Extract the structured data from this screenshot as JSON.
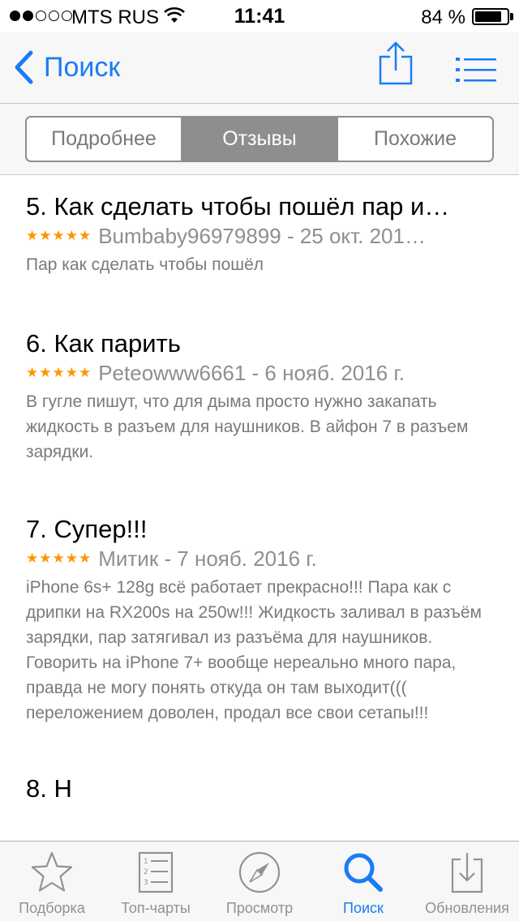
{
  "status_bar": {
    "carrier": "MTS RUS",
    "time": "11:41",
    "battery_percent": "84 %",
    "battery_level": 0.84,
    "signal_bars": 2
  },
  "navbar": {
    "back_label": "Поиск",
    "share_icon": "share-icon",
    "list_icon": "list-icon",
    "accent_color": "#1a7cf5"
  },
  "segmented": {
    "tabs": [
      {
        "label": "Подробнее",
        "active": false
      },
      {
        "label": "Отзывы",
        "active": true
      },
      {
        "label": "Похожие",
        "active": false
      }
    ]
  },
  "reviews": [
    {
      "title": "5. Как сделать чтобы пошёл пар и…",
      "stars": "★★★★★",
      "meta": "Bumbaby96979899 - 25 окт. 201…",
      "body": "Пар как сделать чтобы пошёл"
    },
    {
      "title": "6. Как парить",
      "stars": "★★★★★",
      "meta": "Peteowww6661 - 6 нояб. 2016 г.",
      "body": "В гугле пишут, что для дыма просто нужно закапать жидкость в разъем для наушников. В айфон 7 в разъем зарядки."
    },
    {
      "title": "7. Супер!!!",
      "stars": "★★★★★",
      "meta": "Митик - 7 нояб. 2016 г.",
      "body": "iPhone 6s+ 128g всё работает прекрасно!!! Пара как с дрипки на RX200s на 250w!!! Жидкость заливал в разъём зарядки, пар затягивал из разъёма для наушников. Говорить на iPhone 7+ вообще нереально много пара, правда не могу понять откуда он там выходит((( переложением доволен, продал все свои сетапы!!!"
    },
    {
      "title": "8. Н",
      "stars": "",
      "meta": "",
      "body": ""
    }
  ],
  "tabbar": {
    "items": [
      {
        "label": "Подборка",
        "icon": "star-icon",
        "active": false
      },
      {
        "label": "Топ-чарты",
        "icon": "top-charts-icon",
        "active": false
      },
      {
        "label": "Просмотр",
        "icon": "compass-icon",
        "active": false
      },
      {
        "label": "Поиск",
        "icon": "search-icon",
        "active": true
      },
      {
        "label": "Обновления",
        "icon": "updates-icon",
        "active": false
      }
    ]
  }
}
